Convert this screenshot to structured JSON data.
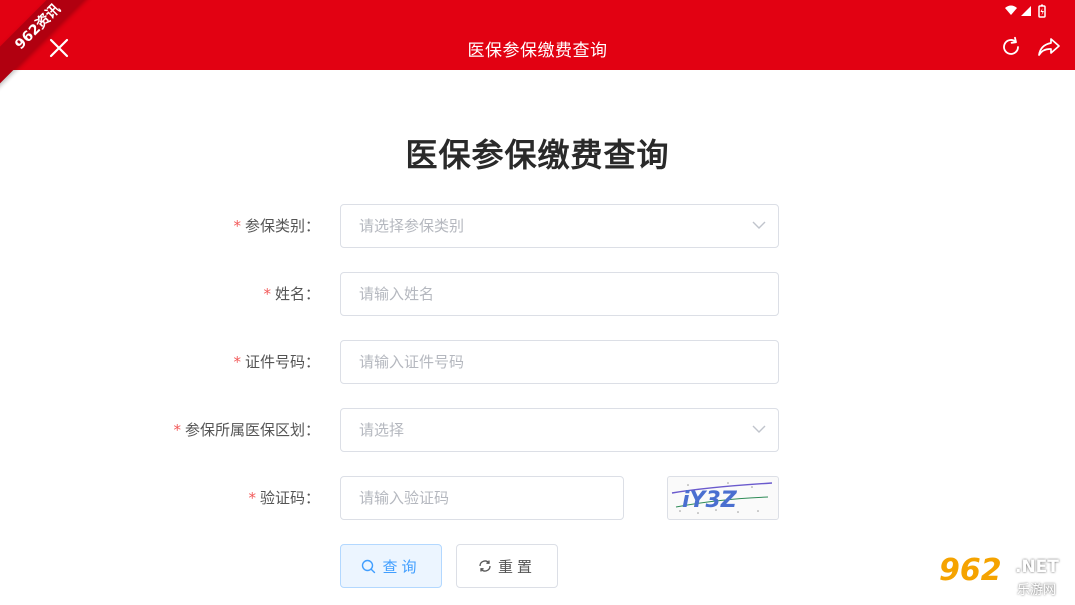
{
  "app": {
    "title": "医保参保缴费查询",
    "watermark_corner": "962资讯",
    "watermark_logo": "962",
    "watermark_net": ".NET",
    "watermark_sub": "乐游网",
    "brand_color": "#e20112"
  },
  "form": {
    "heading": "医保参保缴费查询",
    "required_mark": "*",
    "fields": [
      {
        "label": "参保类别：",
        "placeholder": "请选择参保类别",
        "type": "select"
      },
      {
        "label": "姓名：",
        "placeholder": "请输入姓名",
        "type": "text"
      },
      {
        "label": "证件号码：",
        "placeholder": "请输入证件号码",
        "type": "text"
      },
      {
        "label": "参保所属医保区划：",
        "placeholder": "请选择",
        "type": "select"
      },
      {
        "label": "验证码：",
        "placeholder": "请输入验证码",
        "type": "text"
      }
    ],
    "captcha_text": "iY3Z",
    "query_button": "查询",
    "reset_button": "重置"
  },
  "icons": {
    "close": "close-icon",
    "refresh": "refresh-icon",
    "share": "share-icon",
    "search": "search-icon",
    "reset": "refresh-icon",
    "chevron": "chevron-down-icon"
  }
}
